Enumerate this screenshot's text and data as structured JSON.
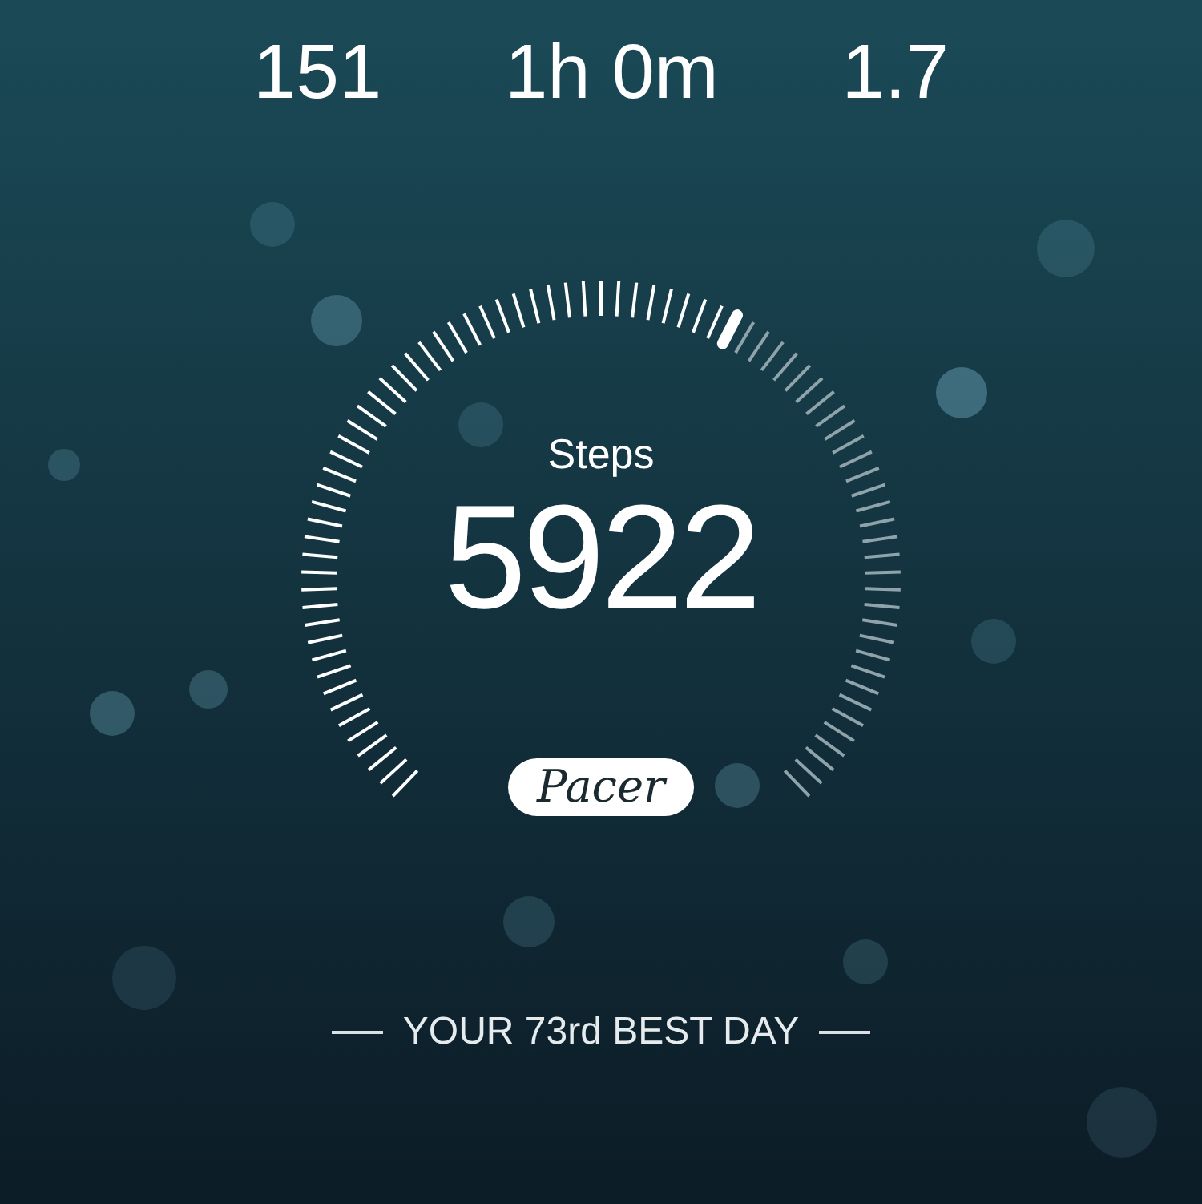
{
  "stats": [
    {
      "value": "151"
    },
    {
      "value": "1h 0m"
    },
    {
      "value": "1.7"
    }
  ],
  "gauge": {
    "label": "Steps",
    "value": "5922"
  },
  "brand": "Pacer",
  "footer": "YOUR 73rd BEST DAY"
}
